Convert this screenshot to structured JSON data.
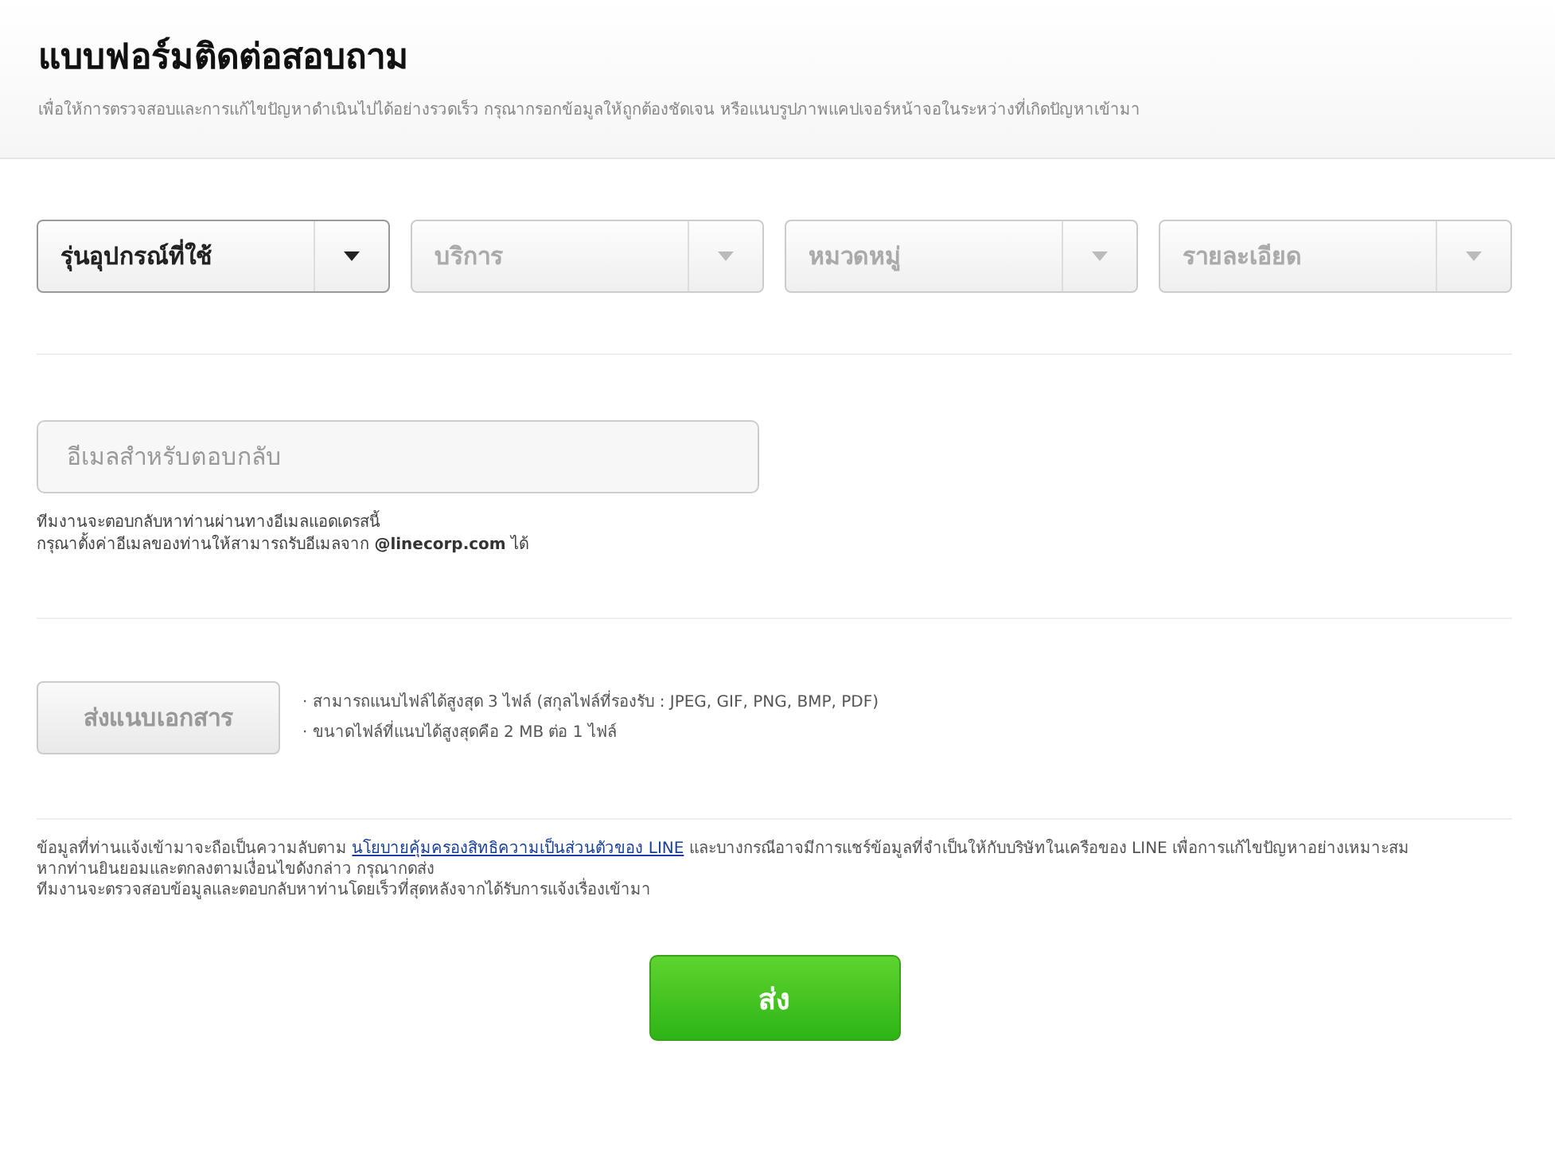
{
  "header": {
    "title": "แบบฟอร์มติดต่อสอบถาม",
    "subtitle": "เพื่อให้การตรวจสอบและการแก้ไขปัญหาดำเนินไปได้อย่างรวดเร็ว กรุณากรอกข้อมูลให้ถูกต้องชัดเจน หรือแนบรูปภาพแคปเจอร์หน้าจอในระหว่างที่เกิดปัญหาเข้ามา"
  },
  "selects": [
    {
      "label": "รุ่นอุปกรณ์ที่ใช้",
      "disabled": false
    },
    {
      "label": "บริการ",
      "disabled": true
    },
    {
      "label": "หมวดหมู่",
      "disabled": true
    },
    {
      "label": "รายละเอียด",
      "disabled": true
    }
  ],
  "email": {
    "placeholder": "อีเมลสำหรับตอบกลับ",
    "notes": [
      "ทีมงานจะตอบกลับหาท่านผ่านทางอีเมลแอดเดรสนี้",
      "กรุณาตั้งค่าอีเมลของท่านให้สามารถรับอีเมลจาก **@linecorp.com** ได้"
    ]
  },
  "attachment": {
    "button": "ส่งแนบเอกสาร",
    "disabled": true,
    "notes": [
      "· สามารถแนบไฟล์ได้สูงสุด 3 ไฟล์ (สกุลไฟล์ที่รองรับ : JPEG, GIF, PNG, BMP, PDF)",
      "· ขนาดไฟล์ที่แนบได้สูงสุดคือ 2 MB ต่อ 1 ไฟล์"
    ]
  },
  "privacy": {
    "before": "ข้อมูลที่ท่านแจ้งเข้ามาจะถือเป็นความลับตาม",
    "link": "นโยบายคุ้มครองสิทธิความเป็นส่วนตัวของ LINE",
    "after": "และบางกรณีอาจมีการแชร์ข้อมูลที่จำเป็นให้กับบริษัทในเครือของ LINE เพื่อการแก้ไขปัญหาอย่างเหมาะสม",
    "lines": [
      "หากท่านยินยอมและตกลงตามเงื่อนไขดังกล่าว กรุณากดส่ง",
      "ทีมงานจะตรวจสอบข้อมูลและตอบกลับหาท่านโดยเร็วที่สุดหลังจากได้รับการแจ้งเรื่องเข้ามา"
    ]
  },
  "submit": "ส่ง"
}
